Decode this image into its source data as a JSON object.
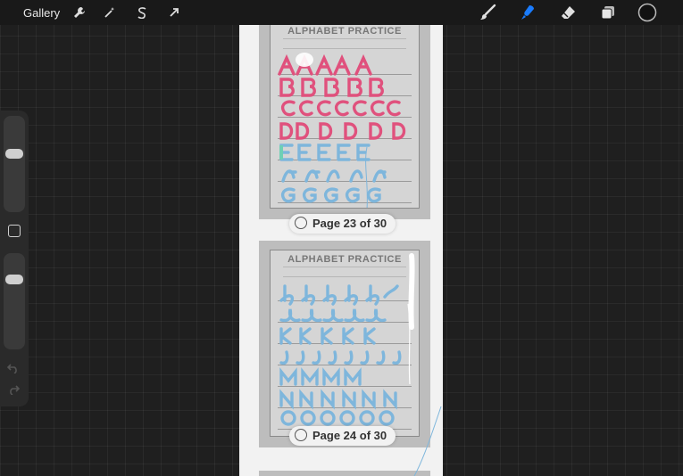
{
  "topbar": {
    "gallery_label": "Gallery",
    "left_tools": [
      "wrench-icon",
      "magic-wand-icon",
      "selection-icon",
      "transform-arrow-icon"
    ],
    "right_tools": [
      "brush-icon",
      "smudge-icon",
      "eraser-icon",
      "layers-icon",
      "color-icon"
    ],
    "active_tool": "smudge-icon",
    "accent": "#1a7cff"
  },
  "sidebar": {
    "brush_size": 0.38,
    "opacity": 0.25,
    "undo": "undo-icon",
    "redo": "redo-icon"
  },
  "pages": [
    {
      "title": "ALPHABET PRACTICE",
      "label": "Page 23 of 30"
    },
    {
      "title": "ALPHABET PRACTICE",
      "label": "Page 24 of 30"
    }
  ],
  "colors": {
    "pink": "#e0517d",
    "blue": "#7eb6dc",
    "teal": "#6fd0b4"
  }
}
